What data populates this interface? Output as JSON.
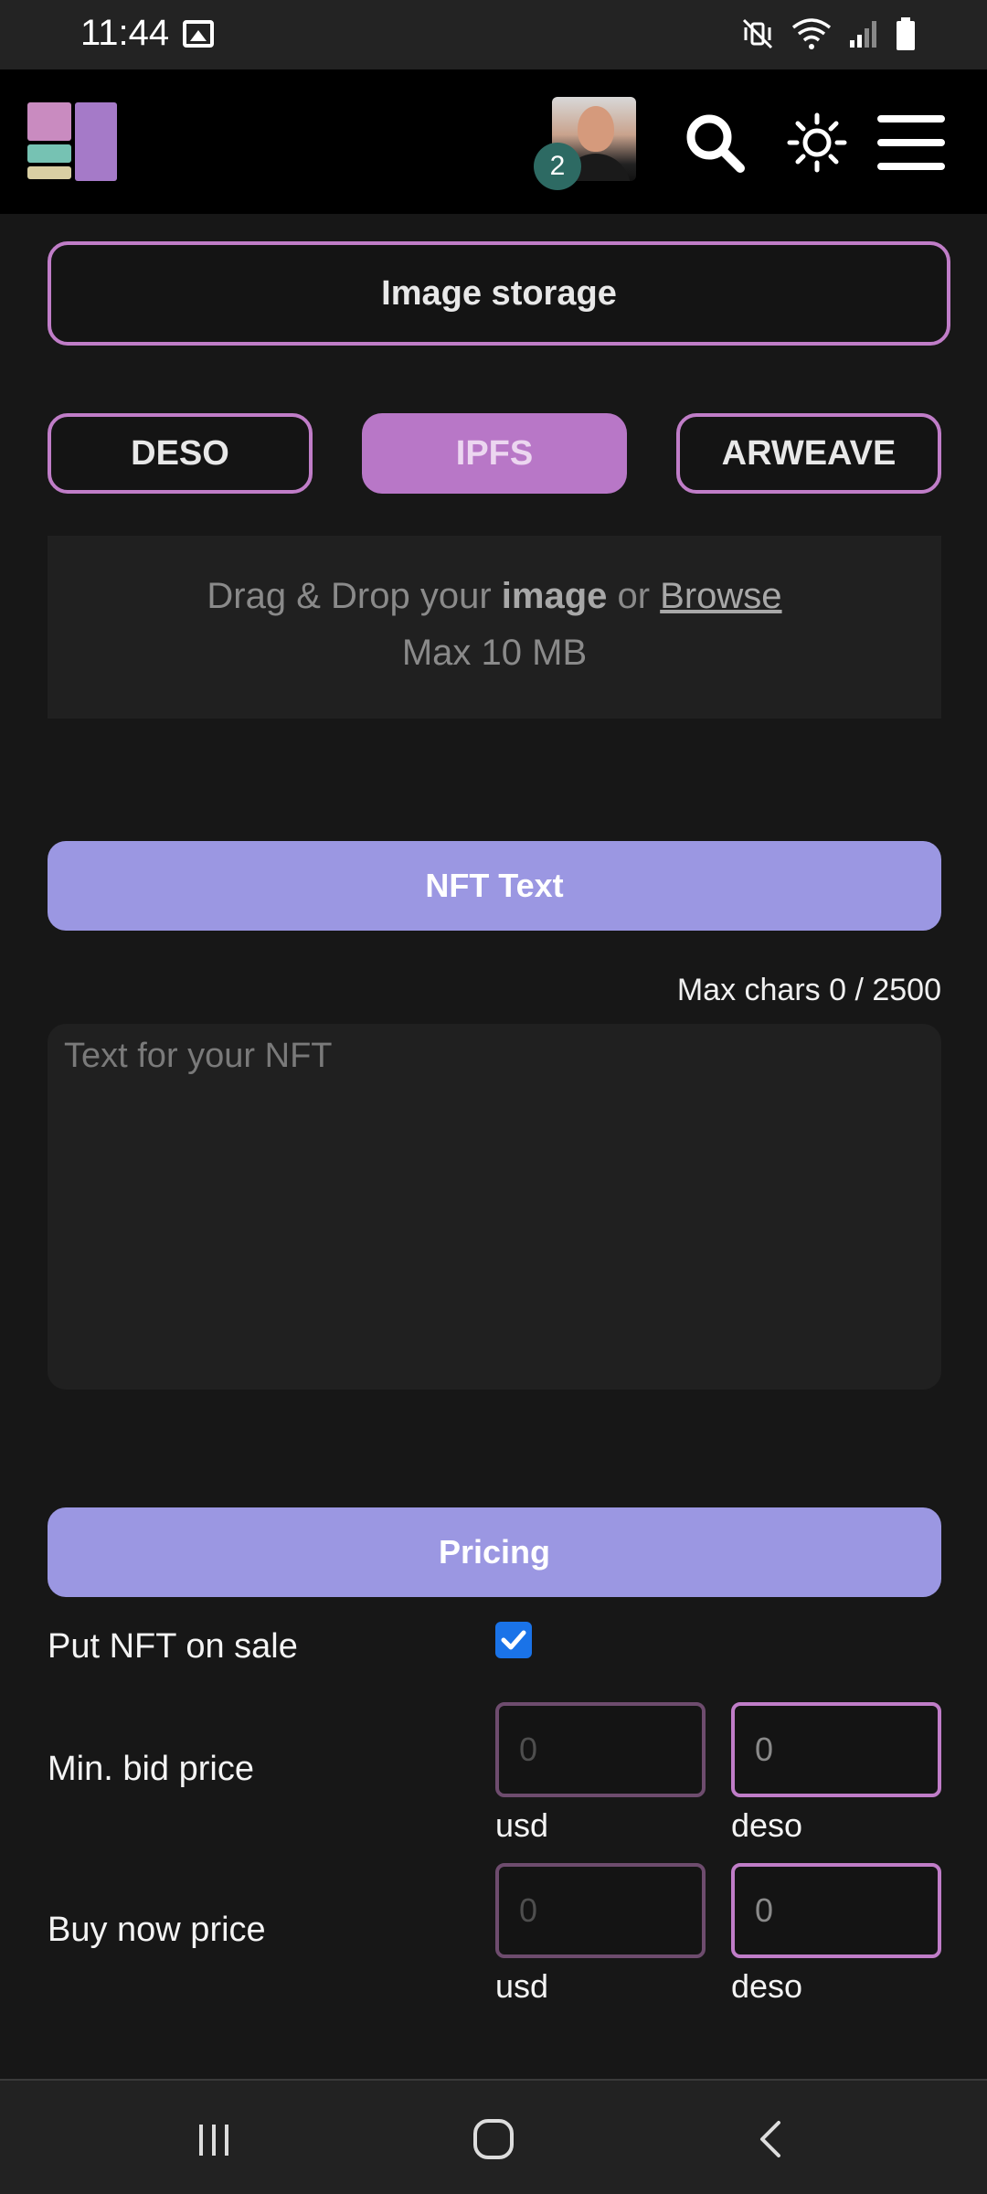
{
  "status_bar": {
    "time": "11:44"
  },
  "header": {
    "notification_count": "2"
  },
  "image_storage": {
    "label": "Image storage",
    "options": [
      "DESO",
      "IPFS",
      "ARWEAVE"
    ],
    "selected": "IPFS"
  },
  "dropzone": {
    "prefix": "Drag & Drop your ",
    "bold": "image",
    "middle": " or ",
    "link": "Browse",
    "max_size": "Max 10 MB"
  },
  "nft_text": {
    "section_label": "NFT Text",
    "char_counter": "Max chars 0 / 2500",
    "placeholder": "Text for your NFT"
  },
  "pricing": {
    "section_label": "Pricing",
    "on_sale_label": "Put NFT on sale",
    "on_sale_checked": true,
    "min_bid_label": "Min. bid price",
    "buy_now_label": "Buy now price",
    "usd_placeholder": "0",
    "deso_placeholder": "0",
    "usd_unit": "usd",
    "deso_unit": "deso"
  },
  "colors": {
    "accent_outline": "#c07dc8",
    "section_button": "#9b97e2",
    "selected_tab": "#b877c7"
  }
}
